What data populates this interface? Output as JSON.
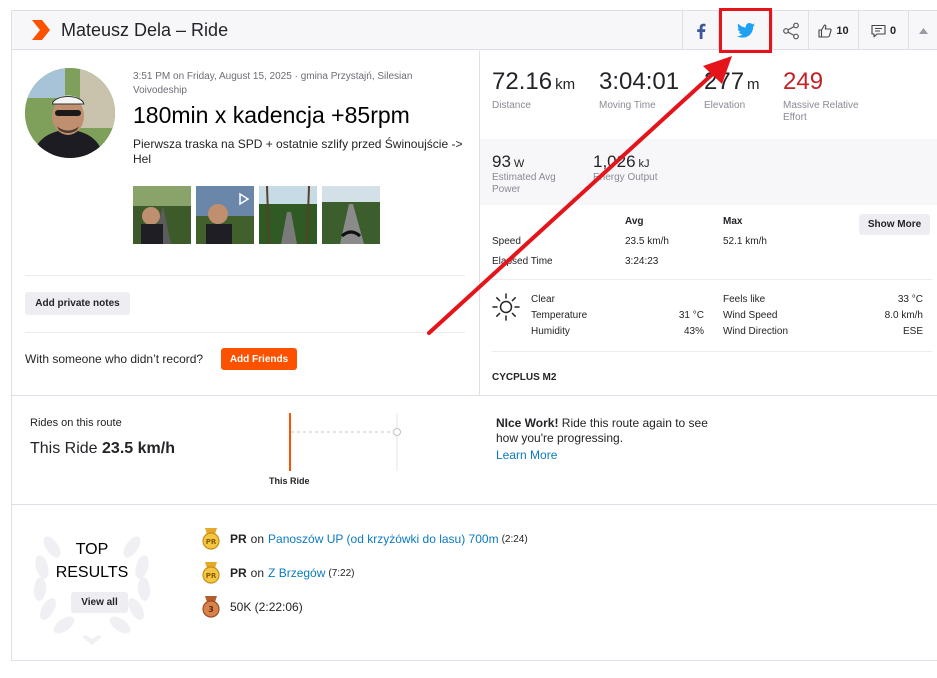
{
  "header": {
    "title": "Mateusz Dela – Ride",
    "kudos_count": "10",
    "comments_count": "0"
  },
  "activity": {
    "meta": "3:51 PM on Friday, August 15, 2025 · gmina Przystajń, Silesian Voivodeship",
    "title": "180min x kadencja +85rpm",
    "description": "Pierwsza traska na SPD + ostatnie szlify przed Świnoujście -> Hel",
    "private_notes_label": "Add private notes",
    "with_someone_text": "With someone who didn’t record?",
    "add_friends_label": "Add Friends"
  },
  "stats": {
    "distance": {
      "value": "72.16",
      "unit": "km",
      "label": "Distance"
    },
    "moving_time": {
      "value": "3:04:01",
      "label": "Moving Time"
    },
    "elevation": {
      "value": "277",
      "unit": "m",
      "label": "Elevation"
    },
    "relative_effort": {
      "value": "249",
      "label_1": "Massive Relative",
      "label_2": "Effort"
    },
    "power": {
      "value": "93",
      "unit": "W",
      "label_1": "Estimated Avg",
      "label_2": "Power"
    },
    "energy": {
      "value": "1,026",
      "unit": "kJ",
      "label": "Energy Output"
    }
  },
  "table": {
    "col_avg": "Avg",
    "col_max": "Max",
    "show_more_label": "Show More",
    "speed_label": "Speed",
    "speed_avg": "23.5 km/h",
    "speed_max": "52.1 km/h",
    "elapsed_label": "Elapsed Time",
    "elapsed_avg": "3:24:23"
  },
  "weather": {
    "condition": "Clear",
    "temperature_label": "Temperature",
    "temperature_value": "31 °C",
    "humidity_label": "Humidity",
    "humidity_value": "43%",
    "feels_like_label": "Feels like",
    "feels_like_value": "33 °C",
    "wind_speed_label": "Wind Speed",
    "wind_speed_value": "8.0 km/h",
    "wind_dir_label": "Wind Direction",
    "wind_dir_value": "ESE"
  },
  "device": "CYCPLUS M2",
  "route": {
    "label": "Rides on this route",
    "value_prefix": "This Ride",
    "value_speed": "23.5 km/h",
    "chart_label": "This Ride",
    "nice_bold": "NIce Work!",
    "nice_text": " Ride this route again to see how you're progressing.",
    "learn_more": "Learn More"
  },
  "top_results": {
    "title_1": "TOP",
    "title_2": "RESULTS",
    "view_all": "View all",
    "items": [
      {
        "bold": "PR",
        "on": "on",
        "segment": "Panoszów UP (od krzyżówki do lasu) 700m",
        "time": "(2:24)",
        "medal_text": "PR"
      },
      {
        "bold": "PR",
        "on": "on",
        "segment": "Z Brzegów",
        "time": "(7:22)",
        "medal_text": "PR"
      },
      {
        "bold": "",
        "on": "",
        "segment": "",
        "time": "50K  (2:22:06)",
        "medal_text": "3"
      }
    ]
  },
  "colors": {
    "brand": "#fc5200",
    "link": "#0a7bc2",
    "effort_red": "#c22126",
    "annotation_red": "#e5141b",
    "twitter_blue": "#1da1f2",
    "facebook_blue": "#3b5998"
  }
}
